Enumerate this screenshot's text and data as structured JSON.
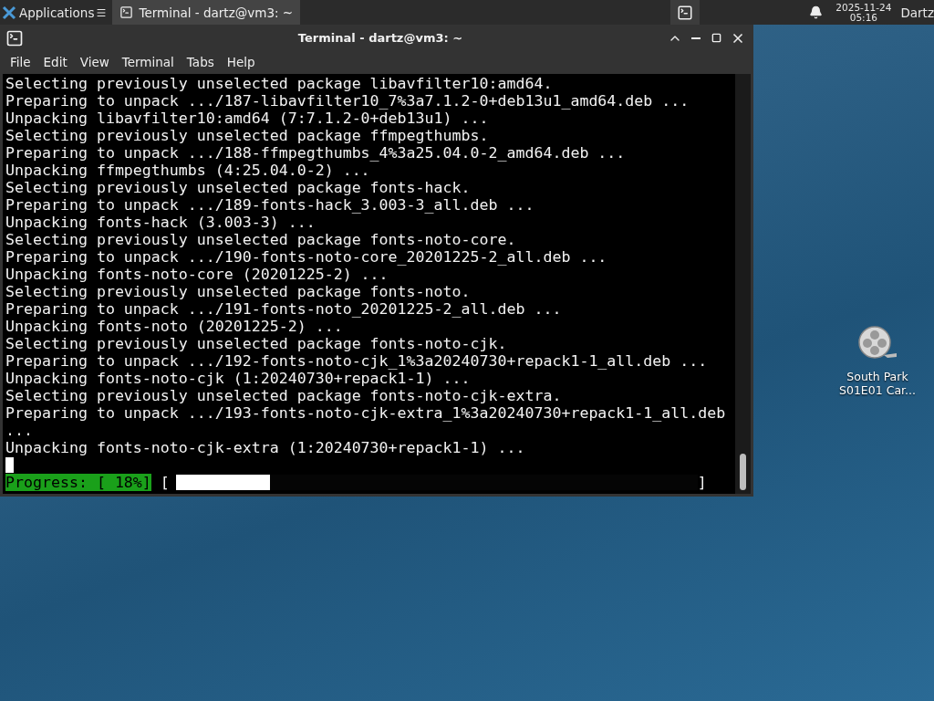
{
  "panel": {
    "applications": "Applications",
    "tasks": [
      {
        "label": "Terminal - dartz@vm3: ~",
        "selected": true
      }
    ],
    "clock": {
      "date": "2025-11-24",
      "time": "05:16"
    },
    "user": "Dartz"
  },
  "window": {
    "title": "Terminal - dartz@vm3: ~",
    "menu": [
      "File",
      "Edit",
      "View",
      "Terminal",
      "Tabs",
      "Help"
    ],
    "lines": [
      "Selecting previously unselected package libavfilter10:amd64.",
      "Preparing to unpack .../187-libavfilter10_7%3a7.1.2-0+deb13u1_amd64.deb ...",
      "Unpacking libavfilter10:amd64 (7:7.1.2-0+deb13u1) ...",
      "Selecting previously unselected package ffmpegthumbs.",
      "Preparing to unpack .../188-ffmpegthumbs_4%3a25.04.0-2_amd64.deb ...",
      "Unpacking ffmpegthumbs (4:25.04.0-2) ...",
      "Selecting previously unselected package fonts-hack.",
      "Preparing to unpack .../189-fonts-hack_3.003-3_all.deb ...",
      "Unpacking fonts-hack (3.003-3) ...",
      "Selecting previously unselected package fonts-noto-core.",
      "Preparing to unpack .../190-fonts-noto-core_20201225-2_all.deb ...",
      "Unpacking fonts-noto-core (20201225-2) ...",
      "Selecting previously unselected package fonts-noto.",
      "Preparing to unpack .../191-fonts-noto_20201225-2_all.deb ...",
      "Unpacking fonts-noto (20201225-2) ...",
      "Selecting previously unselected package fonts-noto-cjk.",
      "Preparing to unpack .../192-fonts-noto-cjk_1%3a20240730+repack1-1_all.deb ...",
      "Unpacking fonts-noto-cjk (1:20240730+repack1-1) ...",
      "Selecting previously unselected package fonts-noto-cjk-extra.",
      "Preparing to unpack .../193-fonts-noto-cjk-extra_1%3a20240730+repack1-1_all.deb",
      "...",
      "Unpacking fonts-noto-cjk-extra (1:20240730+repack1-1) ..."
    ],
    "progress": {
      "label": "Progress: [ 18%]",
      "open": "[",
      "close": "]",
      "level": 0.18
    }
  },
  "desktop_icons": [
    {
      "label": "South Park S01E01 Car..."
    }
  ]
}
